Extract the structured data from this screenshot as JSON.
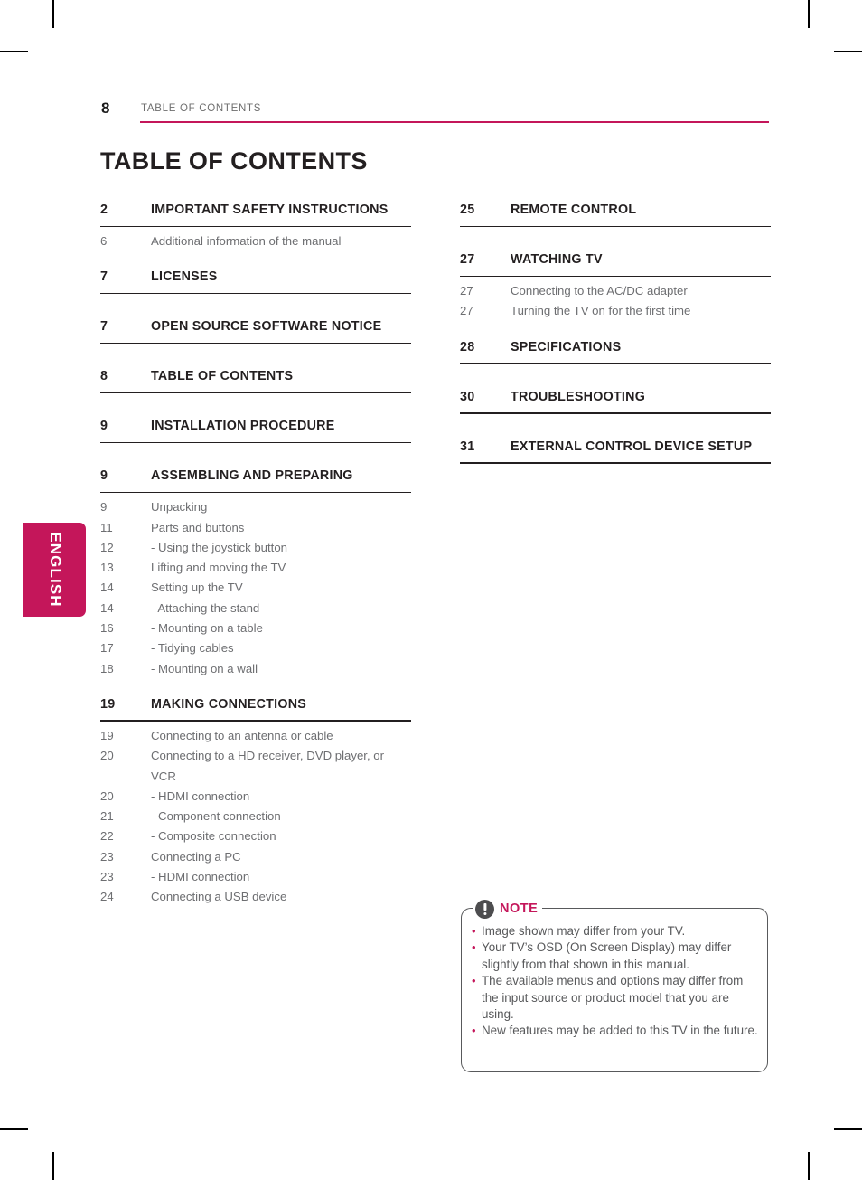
{
  "colors": {
    "accent": "#C4165A",
    "text_dark": "#231f20",
    "text_gray": "#6d6e71",
    "note_border": "#58595b"
  },
  "side_tab": {
    "label": "ENGLISH"
  },
  "header": {
    "page_number": "8",
    "breadcrumb": "TABLE OF CONTENTS"
  },
  "title": "TABLE OF CONTENTS",
  "columns": {
    "left": [
      {
        "page": "2",
        "heading": "IMPORTANT SAFETY INSTRUCTIONS",
        "entries": [
          {
            "page": "6",
            "label": "Additional information of the manual",
            "dash": false
          }
        ]
      },
      {
        "page": "7",
        "heading": "LICENSES",
        "entries": []
      },
      {
        "page": "7",
        "heading": "OPEN SOURCE SOFTWARE NOTICE",
        "entries": []
      },
      {
        "page": "8",
        "heading": "TABLE OF CONTENTS",
        "entries": []
      },
      {
        "page": "9",
        "heading": "INSTALLATION PROCEDURE",
        "entries": []
      },
      {
        "page": "9",
        "heading": "ASSEMBLING AND PREPARING",
        "entries": [
          {
            "page": "9",
            "label": "Unpacking",
            "dash": false
          },
          {
            "page": "11",
            "label": "Parts and buttons",
            "dash": false
          },
          {
            "page": "12",
            "label": "-  Using the joystick button",
            "dash": true
          },
          {
            "page": "13",
            "label": "Lifting and moving the TV",
            "dash": false
          },
          {
            "page": "14",
            "label": "Setting up the TV",
            "dash": false
          },
          {
            "page": "14",
            "label": "-  Attaching the stand",
            "dash": true
          },
          {
            "page": "16",
            "label": "-  Mounting on a table",
            "dash": true
          },
          {
            "page": "17",
            "label": "-  Tidying cables",
            "dash": true
          },
          {
            "page": "18",
            "label": "-  Mounting on a wall",
            "dash": true
          }
        ]
      },
      {
        "page": "19",
        "heading": "MAKING CONNECTIONS",
        "entries": [
          {
            "page": "19",
            "label": "Connecting to an antenna or cable",
            "dash": false
          },
          {
            "page": "20",
            "label": "Connecting to a HD receiver, DVD player, or VCR",
            "dash": false
          },
          {
            "page": "20",
            "label": "-  HDMI connection",
            "dash": true
          },
          {
            "page": "21",
            "label": "-  Component connection",
            "dash": true
          },
          {
            "page": "22",
            "label": "-  Composite connection",
            "dash": true
          },
          {
            "page": "23",
            "label": "Connecting a PC",
            "dash": false
          },
          {
            "page": "23",
            "label": "-  HDMI connection",
            "dash": true
          },
          {
            "page": "24",
            "label": "Connecting a USB device",
            "dash": false
          }
        ]
      }
    ],
    "right": [
      {
        "page": "25",
        "heading": "REMOTE CONTROL",
        "entries": []
      },
      {
        "page": "27",
        "heading": "WATCHING TV",
        "entries": [
          {
            "page": "27",
            "label": "Connecting to the AC/DC adapter",
            "dash": false
          },
          {
            "page": "27",
            "label": "Turning the TV on for the first time",
            "dash": false
          }
        ]
      },
      {
        "page": "28",
        "heading": "SPECIFICATIONS",
        "entries": []
      },
      {
        "page": "30",
        "heading": "TROUBLESHOOTING",
        "entries": []
      },
      {
        "page": "31",
        "heading": "EXTERNAL CONTROL DEVICE SETUP",
        "entries": []
      }
    ]
  },
  "note": {
    "icon": "exclamation-circle-icon",
    "title": "NOTE",
    "bullet": "•",
    "items": [
      "Image shown may differ from your TV.",
      "Your TV’s OSD (On Screen Display) may differ slightly from that shown in this manual.",
      "The available menus and options may differ from the input source or product model that you are using.",
      "New features may be added to this TV in the future."
    ]
  }
}
